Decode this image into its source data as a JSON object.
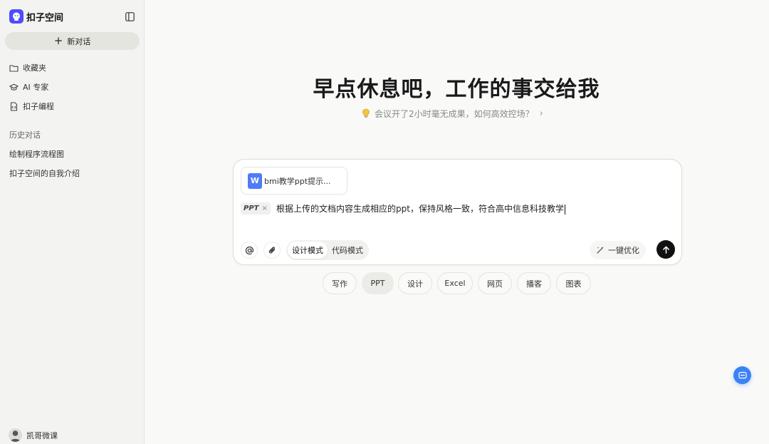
{
  "app": {
    "name": "扣子空间"
  },
  "sidebar": {
    "new_chat_label": "新对话",
    "nav": [
      {
        "label": "收藏夹",
        "icon": "folder-icon"
      },
      {
        "label": "AI 专家",
        "icon": "graduation-cap-icon"
      },
      {
        "label": "扣子编程",
        "icon": "code-file-icon"
      }
    ],
    "history_title": "历史对话",
    "history": [
      {
        "label": "绘制程序流程图"
      },
      {
        "label": "扣子空间的自我介绍"
      }
    ],
    "user": {
      "name": "凯哥微课"
    }
  },
  "main": {
    "title": "早点休息吧，工作的事交给我",
    "suggestion": "会议开了2小时毫无成果，如何高效控场？",
    "composer": {
      "attachment": {
        "name": "bmi教学ppt提示...",
        "type_letter": "W"
      },
      "tag": "PPT",
      "tag_remove": "×",
      "prompt": "根据上传的文档内容生成相应的ppt，保持风格一致，符合高中信息科技教学",
      "modes": [
        {
          "label": "设计模式",
          "active": true
        },
        {
          "label": "代码模式",
          "active": false
        }
      ],
      "optimize_label": "一键优化"
    },
    "chips": [
      {
        "label": "写作",
        "active": false
      },
      {
        "label": "PPT",
        "active": true
      },
      {
        "label": "设计",
        "active": false
      },
      {
        "label": "Excel",
        "active": false
      },
      {
        "label": "网页",
        "active": false
      },
      {
        "label": "播客",
        "active": false
      },
      {
        "label": "图表",
        "active": false
      }
    ]
  },
  "colors": {
    "accent": "#4d4dff",
    "send": "#111111",
    "float_button": "#3b82f6",
    "file_icon": "#4f7cf6"
  }
}
